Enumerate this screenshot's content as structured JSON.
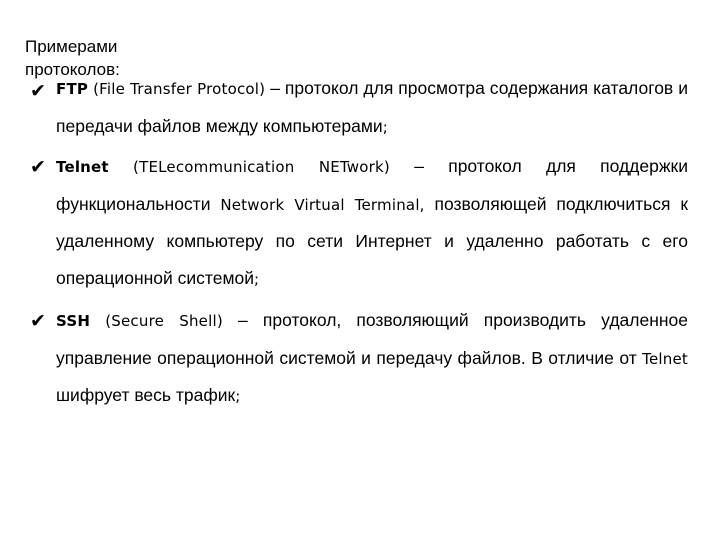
{
  "heading": "Примерами протоколов:",
  "bullet_icon": "check-mark-icon",
  "bullet_glyph": "✔",
  "items": [
    {
      "term": "FTP",
      "expansion": "(File Transfer Protocol)",
      "dash": "–",
      "description_part1": "протокол для просмотра содержания каталогов и передачи файлов между компьютерами",
      "end": ";"
    },
    {
      "term": "Telnet",
      "expansion": "(TELecommunication NETwork)",
      "dash": "–",
      "description_part1": "протокол для поддержки функциональности",
      "latin_mid": "Network Virtual Terminal,",
      "description_part2": "позволяющей подключиться к удаленному компьютеру по сети Интернет и удаленно работать с его операционной системой",
      "end": ";"
    },
    {
      "term": "SSH",
      "expansion": "(Secure Shell)",
      "dash": "–",
      "description_part1": "протокол, позволяющий производить удаленное управление операционной системой и передачу файлов. В отличие от",
      "latin_mid": "Telnet",
      "description_part2": "шифрует весь трафик",
      "end": ";"
    }
  ]
}
